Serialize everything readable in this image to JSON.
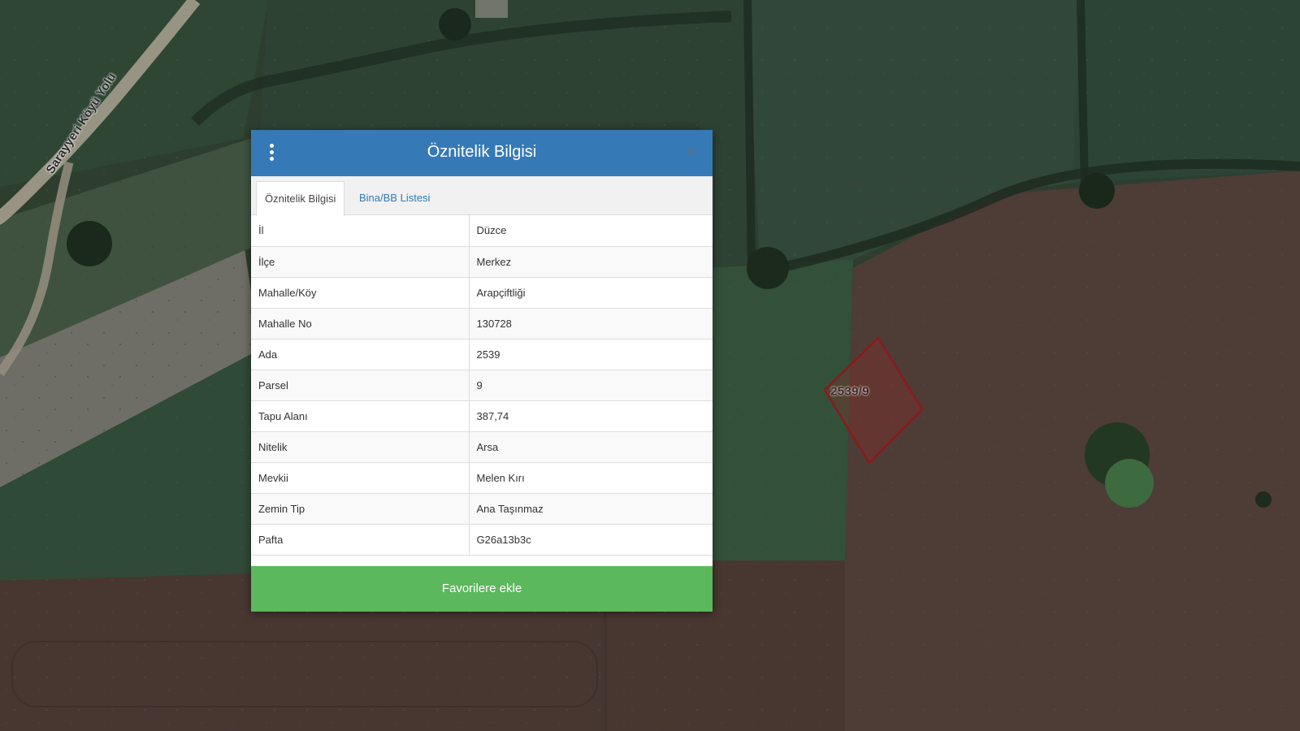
{
  "map": {
    "parcel_label": "2539/9",
    "road_label": "Sarayyeri Köyü Yolu"
  },
  "dialog": {
    "title": "Öznitelik Bilgisi",
    "menu_icon": "vertical-ellipsis-icon",
    "close_icon": "close-icon",
    "close_glyph": "×",
    "tabs": [
      {
        "label": "Öznitelik Bilgisi",
        "active": true
      },
      {
        "label": "Bina/BB Listesi",
        "active": false
      }
    ],
    "rows": [
      {
        "key": "İl",
        "value": "Düzce"
      },
      {
        "key": "İlçe",
        "value": "Merkez"
      },
      {
        "key": "Mahalle/Köy",
        "value": "Arapçiftliği"
      },
      {
        "key": "Mahalle No",
        "value": "130728"
      },
      {
        "key": "Ada",
        "value": "2539"
      },
      {
        "key": "Parsel",
        "value": "9"
      },
      {
        "key": "Tapu Alanı",
        "value": "387,74"
      },
      {
        "key": "Nitelik",
        "value": "Arsa"
      },
      {
        "key": "Mevkii",
        "value": "Melen Kırı"
      },
      {
        "key": "Zemin Tip",
        "value": "Ana Taşınmaz"
      },
      {
        "key": "Pafta",
        "value": "G26a13b3c"
      }
    ],
    "favorite_button": "Favorilere ekle"
  },
  "colors": {
    "header": "#3679b7",
    "favorite_button": "#5cb85c",
    "tab_link": "#337ab7",
    "parcel_outline": "#8b1a1a"
  }
}
